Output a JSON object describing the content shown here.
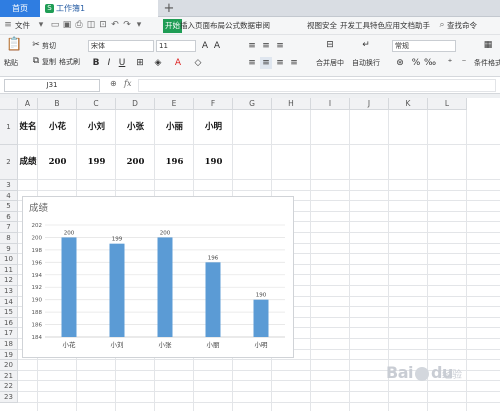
{
  "tabbar": {
    "home_label": "首页",
    "workbook_badge": "S",
    "workbook_label": "工作簿1",
    "new_tab_label": "+"
  },
  "menubar": {
    "file_label": "文件",
    "items": [
      "开始",
      "插入",
      "页面布局",
      "公式",
      "数据",
      "审阅",
      "视图",
      "安全",
      "开发工具",
      "特色应用",
      "文档助手"
    ],
    "search_label": "查找命令"
  },
  "ribbon": {
    "paste_label": "粘贴",
    "cut_label": "剪切",
    "copy_label": "复制",
    "format_painter_label": "格式刷",
    "font_name": "宋体",
    "font_size": "11",
    "merge_center_label": "合并居中",
    "wrap_text_label": "自动换行",
    "number_format": "常规",
    "conditional_format_label": "条件格式"
  },
  "formula_bar": {
    "name_box": "J31",
    "fx_label": "fx",
    "formula": ""
  },
  "columns": [
    "A",
    "B",
    "C",
    "D",
    "E",
    "F",
    "G",
    "H",
    "I",
    "J",
    "K",
    "L"
  ],
  "rows": [
    "1",
    "2",
    "3",
    "4",
    "5",
    "6",
    "7",
    "8",
    "9",
    "10",
    "11",
    "12",
    "13",
    "14",
    "15",
    "16",
    "17",
    "18",
    "19",
    "20",
    "21",
    "22",
    "23"
  ],
  "sheet": {
    "A1": "姓名",
    "B1": "小花",
    "C1": "小刘",
    "D1": "小张",
    "E1": "小丽",
    "F1": "小明",
    "A2": "成绩",
    "B2": "200",
    "C2": "199",
    "D2": "200",
    "E2": "196",
    "F2": "190"
  },
  "chart_data": {
    "type": "bar",
    "title": "成绩",
    "categories": [
      "小花",
      "小刘",
      "小张",
      "小丽",
      "小明"
    ],
    "values": [
      200,
      199,
      200,
      196,
      190
    ],
    "ylim": [
      184,
      202
    ],
    "yticks": [
      184,
      186,
      188,
      190,
      192,
      194,
      196,
      198,
      200,
      202
    ],
    "grid": true,
    "data_labels": true,
    "bar_color": "#5b9bd5",
    "xlabel": "",
    "ylabel": ""
  },
  "watermark": {
    "text": "Bai",
    "text2": "du",
    "sub": "经验"
  }
}
